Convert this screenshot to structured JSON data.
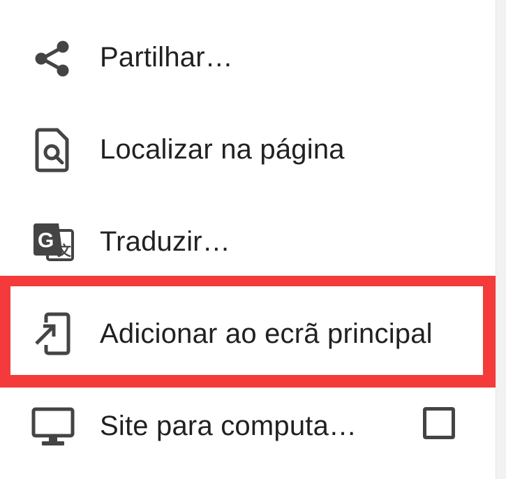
{
  "menu": {
    "items": [
      {
        "label": "Partilhar…",
        "icon": "share-icon"
      },
      {
        "label": "Localizar na página",
        "icon": "find-in-page-icon"
      },
      {
        "label": "Traduzir…",
        "icon": "translate-icon"
      },
      {
        "label": "Adicionar ao ecrã principal",
        "icon": "add-to-home-screen-icon",
        "highlighted": true
      },
      {
        "label": "Site para computa…",
        "icon": "desktop-icon",
        "checkbox_checked": false
      }
    ]
  },
  "colors": {
    "highlight_border": "#f43a3a",
    "icon": "#444444",
    "text": "#212121"
  }
}
